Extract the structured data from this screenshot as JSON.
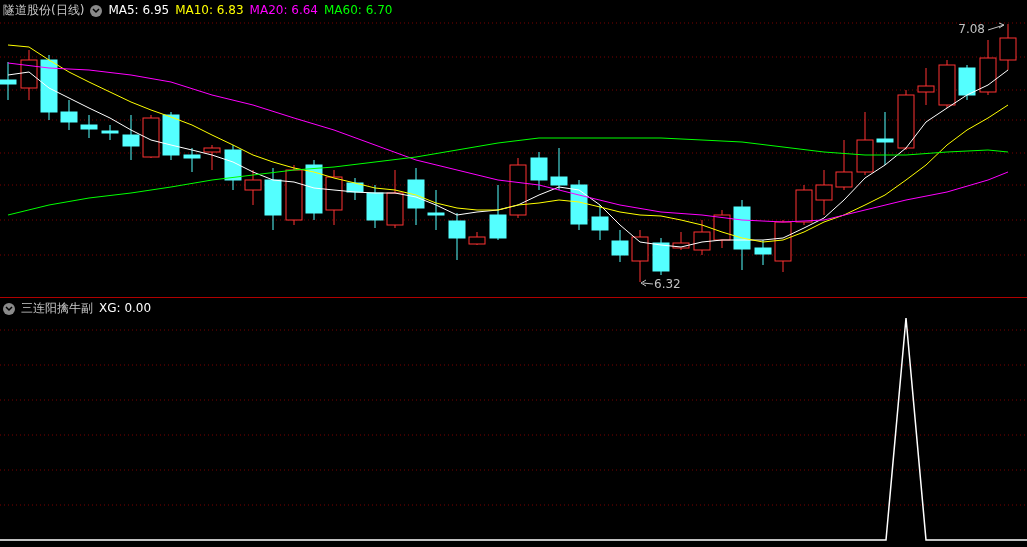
{
  "header": {
    "title": "隧道股份(日线)",
    "ma": [
      {
        "label": "MA5: 6.95",
        "color": "#ffffff"
      },
      {
        "label": "MA10: 6.83",
        "color": "#ffff00"
      },
      {
        "label": "MA20: 6.64",
        "color": "#ff00ff"
      },
      {
        "label": "MA60: 6.70",
        "color": "#00ff00"
      }
    ]
  },
  "price_chart": {
    "high_label": "7.08",
    "low_label": "6.32"
  },
  "indicator": {
    "title": "三连阳擒牛副",
    "reading": "XG: 0.00"
  }
}
